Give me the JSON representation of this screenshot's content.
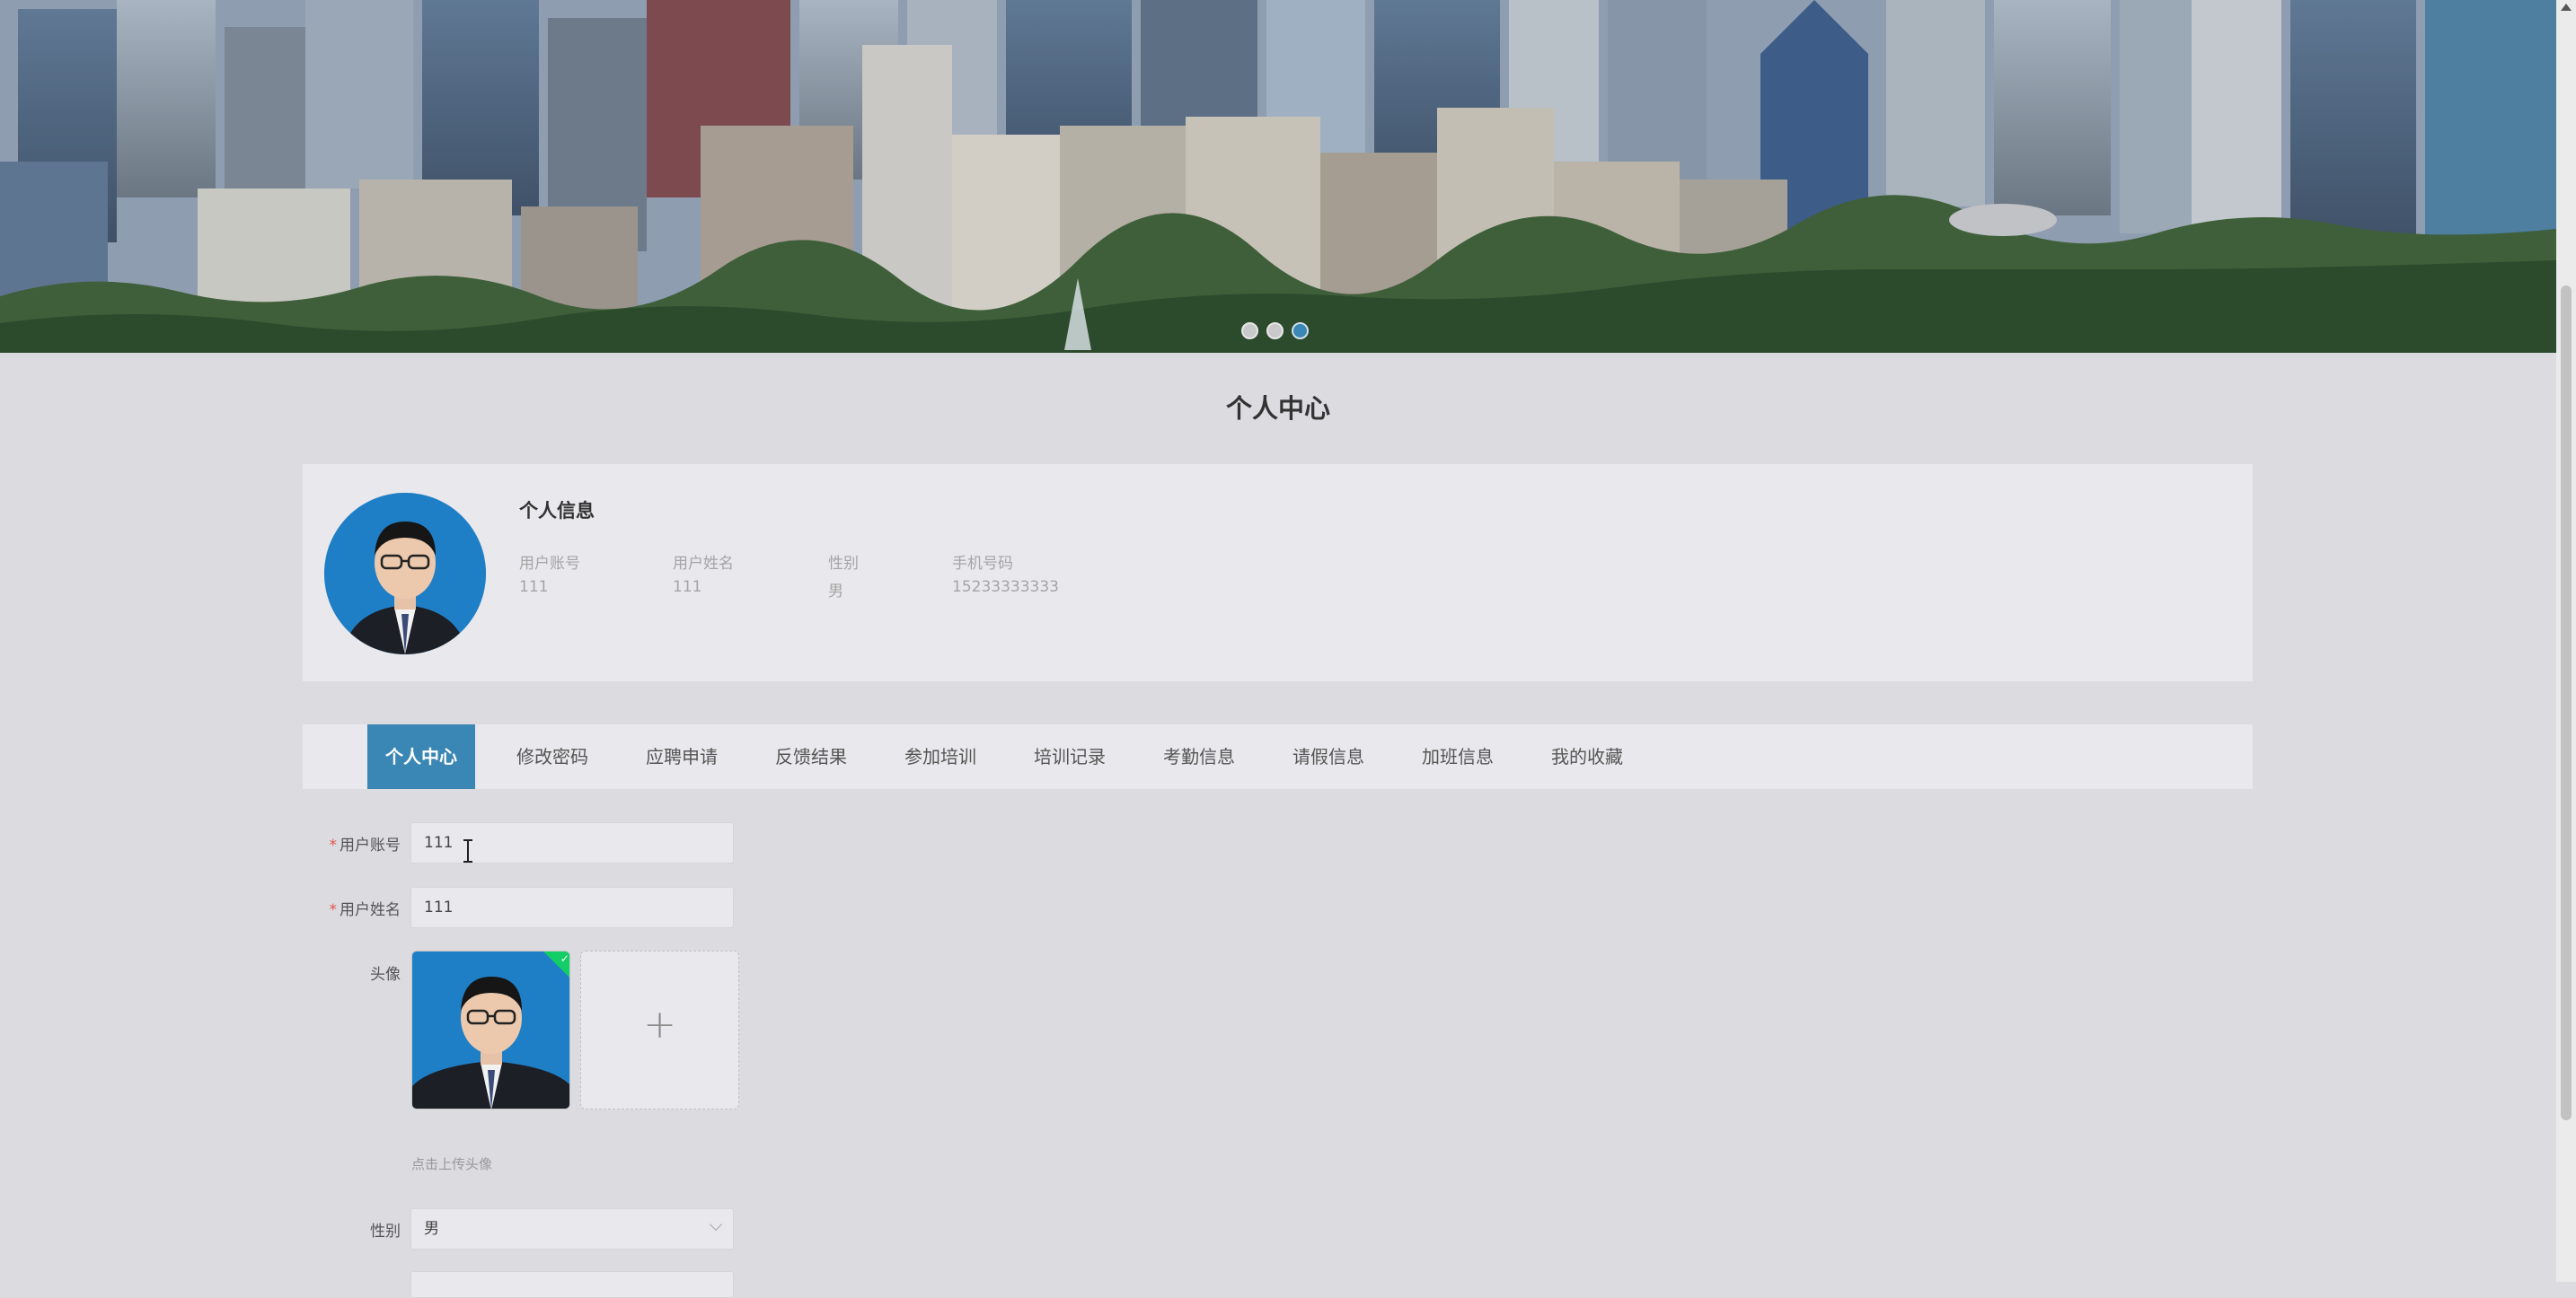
{
  "banner": {
    "slides": [
      "slide-1",
      "slide-2",
      "slide-3"
    ],
    "active_slide": 3
  },
  "page": {
    "title": "个人中心"
  },
  "profile": {
    "section_title": "个人信息",
    "fields": [
      {
        "label": "用户账号",
        "value": "111"
      },
      {
        "label": "用户姓名",
        "value": "111"
      },
      {
        "label": "性别",
        "value": "男"
      },
      {
        "label": "手机号码",
        "value": "15233333333"
      }
    ]
  },
  "tabs": [
    {
      "label": "个人中心",
      "active": true
    },
    {
      "label": "修改密码"
    },
    {
      "label": "应聘申请"
    },
    {
      "label": "反馈结果"
    },
    {
      "label": "参加培训"
    },
    {
      "label": "培训记录"
    },
    {
      "label": "考勤信息"
    },
    {
      "label": "请假信息"
    },
    {
      "label": "加班信息"
    },
    {
      "label": "我的收藏"
    }
  ],
  "form": {
    "account_label": "用户账号",
    "account_value": "111",
    "name_label": "用户姓名",
    "name_value": "111",
    "avatar_label": "头像",
    "upload_plus": "+",
    "upload_tip": "点击上传头像",
    "gender_label": "性别",
    "gender_value": "男",
    "required_mark": "*"
  },
  "colors": {
    "accent": "#3a86b4",
    "background": "#dcdbe0",
    "card": "#e9e8ec",
    "success": "#13ce66",
    "required": "#e0564a"
  }
}
